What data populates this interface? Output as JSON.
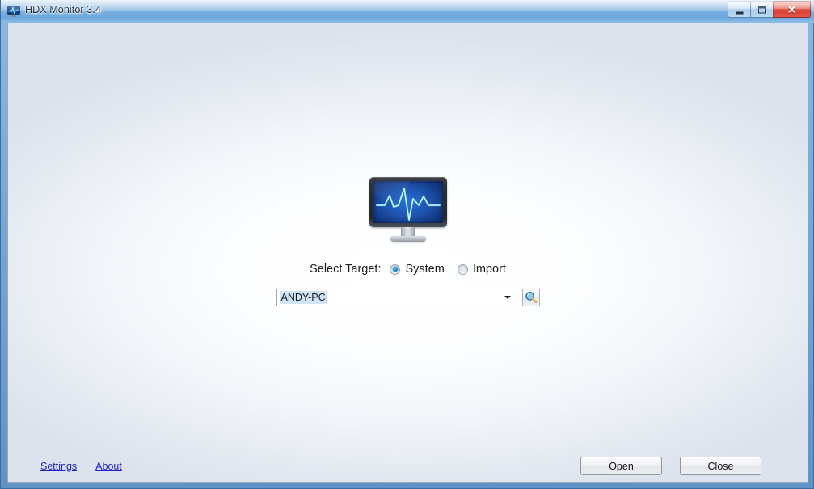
{
  "window": {
    "title": "HDX Monitor 3.4",
    "app_icon": "monitor-waveform-icon",
    "controls": {
      "minimize": "minimize-icon",
      "maximize": "maximize-icon",
      "close": "✕"
    }
  },
  "main": {
    "logo_icon": "monitor-ecg-waveform-logo",
    "target": {
      "label": "Select Target:",
      "options": [
        {
          "label": "System",
          "selected": true
        },
        {
          "label": "Import",
          "selected": false
        }
      ],
      "combo": {
        "value": "ANDY-PC",
        "placeholder": "",
        "arrow_icon": "chevron-down-icon"
      },
      "search_button_icon": "magnifier-icon"
    }
  },
  "footer": {
    "links": [
      {
        "label": "Settings"
      },
      {
        "label": "About"
      }
    ],
    "buttons": [
      {
        "label": "Open"
      },
      {
        "label": "Close"
      }
    ]
  },
  "colors": {
    "title_bar_blue": "#7ba9d4",
    "frame_border": "#3b6ea5",
    "close_red": "#d6392c",
    "link_blue": "#2222cc",
    "selection_blue": "#cfe3f7",
    "screen_blue": "#1d54ae",
    "waveform_cyan": "#6ff2f7"
  }
}
